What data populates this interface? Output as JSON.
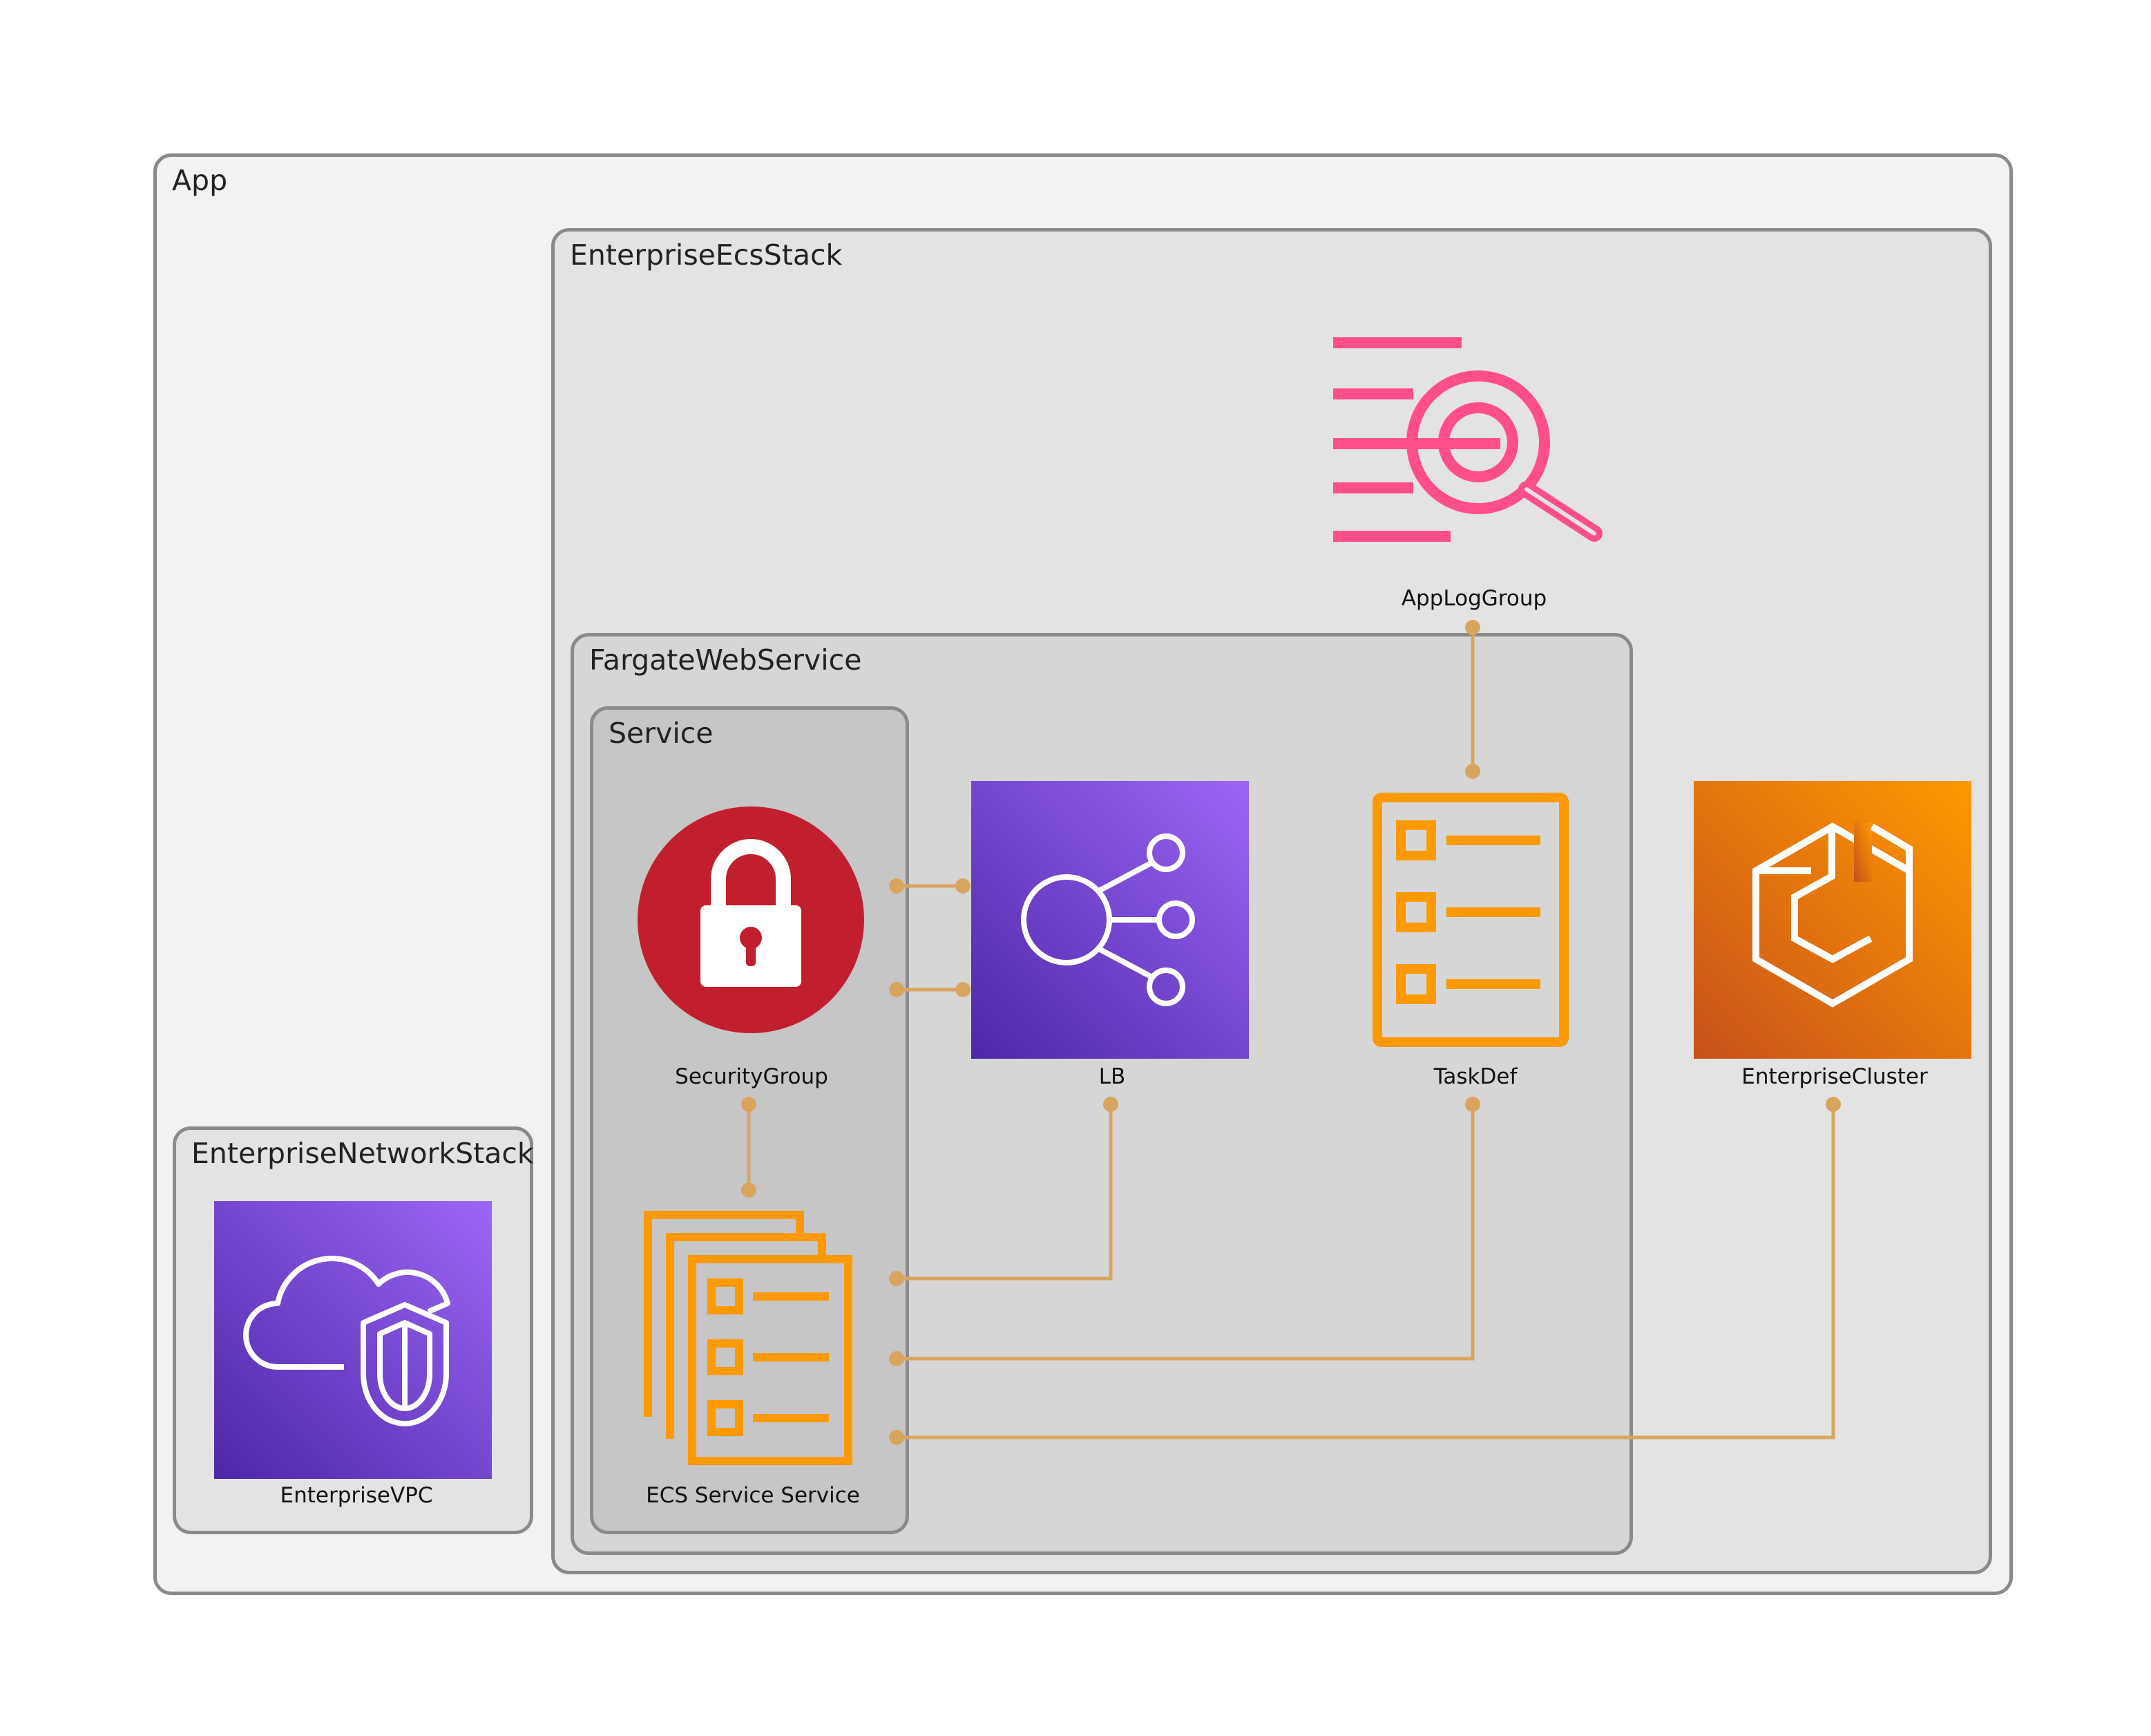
{
  "groups": {
    "app": "App",
    "ecs_stack": "EnterpriseEcsStack",
    "fargate": "FargateWebService",
    "service": "Service",
    "network_stack": "EnterpriseNetworkStack"
  },
  "nodes": {
    "log_group": "AppLogGroup",
    "security_group": "SecurityGroup",
    "lb": "LB",
    "task_def": "TaskDef",
    "cluster": "EnterpriseCluster",
    "ecs_service": "ECS Service Service",
    "vpc": "EnterpriseVPC"
  },
  "icons": {
    "log_group": "log-search-icon",
    "security_group": "padlock-icon",
    "lb": "load-balancer-icon",
    "task_def": "checklist-icon",
    "cluster": "ecs-cluster-icon",
    "ecs_service": "stacked-checklist-icon",
    "vpc": "cloud-shield-icon"
  },
  "colors": {
    "edge": "#d9a55e",
    "log_pink": "#ff4f8b",
    "ecs_orange": "#ff9900",
    "purple_light": "#9c66f5",
    "purple_dark": "#4d27a8",
    "security_red": "#c11f2e",
    "cluster_dark": "#c8511b"
  }
}
